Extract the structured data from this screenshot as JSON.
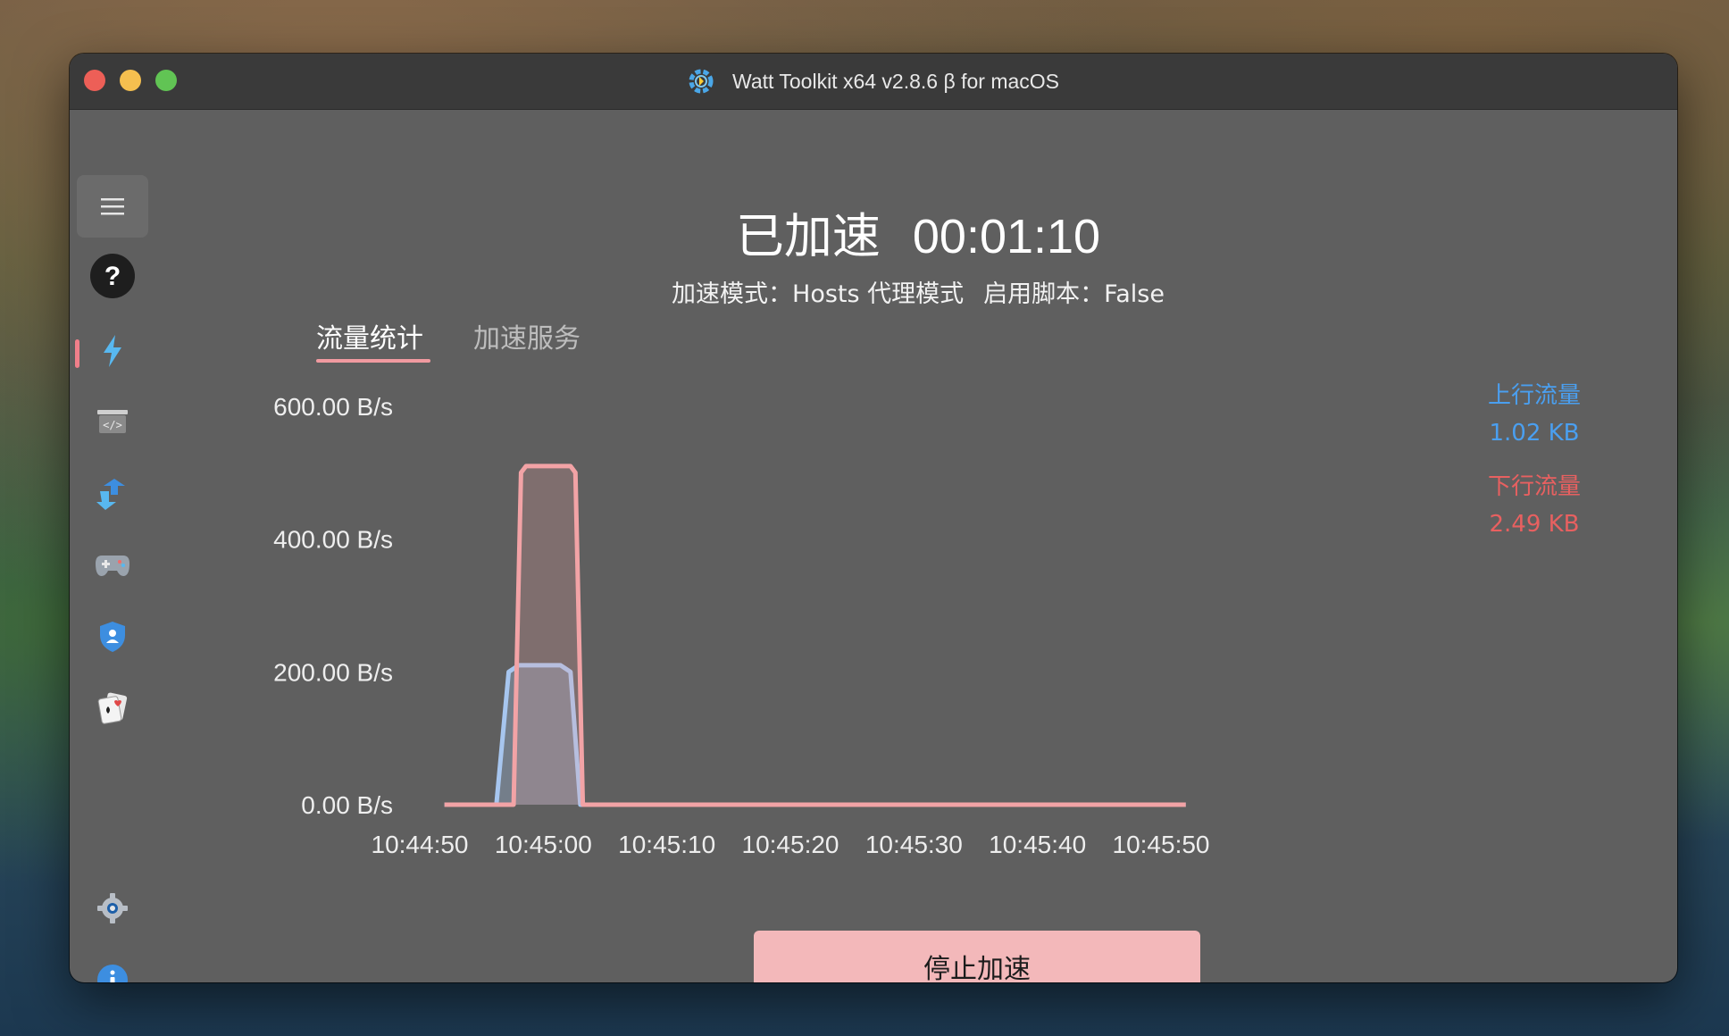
{
  "window": {
    "title": "Watt Toolkit x64 v2.8.6 β for macOS"
  },
  "sidebar": {
    "items": [
      {
        "icon": "hamburger-menu-icon"
      },
      {
        "icon": "help-icon"
      },
      {
        "icon": "lightning-icon",
        "active": true
      },
      {
        "icon": "script-code-icon"
      },
      {
        "icon": "account-switch-icon"
      },
      {
        "icon": "gamepad-icon"
      },
      {
        "icon": "shield-user-icon"
      },
      {
        "icon": "playing-cards-icon"
      },
      {
        "icon": "settings-icon"
      },
      {
        "icon": "info-icon"
      }
    ]
  },
  "status": {
    "label": "已加速",
    "timer": "00:01:10",
    "mode_label": "加速模式：",
    "mode_value": "Hosts 代理模式",
    "script_label": "启用脚本：",
    "script_value": "False"
  },
  "tabs": [
    {
      "label": "流量统计",
      "active": true
    },
    {
      "label": "加速服务",
      "active": false
    }
  ],
  "legend": {
    "upload_label": "上行流量",
    "upload_value": "1.02 KB",
    "download_label": "下行流量",
    "download_value": "2.49 KB"
  },
  "colors": {
    "upload": "#a7c6ef",
    "download": "#f2a3a6",
    "upload_text": "#4a9ff0",
    "download_text": "#e86060",
    "accent": "#f07f8a"
  },
  "chart_data": {
    "type": "area",
    "y_tick_labels": [
      "600.00 B/s",
      "400.00 B/s",
      "200.00 B/s",
      "0.00 B/s"
    ],
    "y_ticks": [
      600,
      400,
      200,
      0
    ],
    "x_tick_labels": [
      "10:44:50",
      "10:45:00",
      "10:45:10",
      "10:45:20",
      "10:45:30",
      "10:45:40",
      "10:45:50"
    ],
    "x_ticks": [
      0,
      10,
      20,
      30,
      40,
      50,
      60
    ],
    "ylim": [
      0,
      600
    ],
    "xlim": [
      0,
      60
    ],
    "series": [
      {
        "name": "上行流量",
        "x": [
          2,
          6.2,
          7.2,
          8,
          11.4,
          12.2,
          13,
          62
        ],
        "y": [
          0,
          0,
          200,
          210,
          210,
          200,
          0,
          0
        ]
      },
      {
        "name": "下行流量",
        "x": [
          2,
          7.6,
          8.2,
          8.6,
          12.2,
          12.6,
          13.2,
          62
        ],
        "y": [
          0,
          0,
          500,
          510,
          510,
          500,
          0,
          0
        ]
      }
    ]
  },
  "actions": {
    "stop_label": "停止加速"
  }
}
